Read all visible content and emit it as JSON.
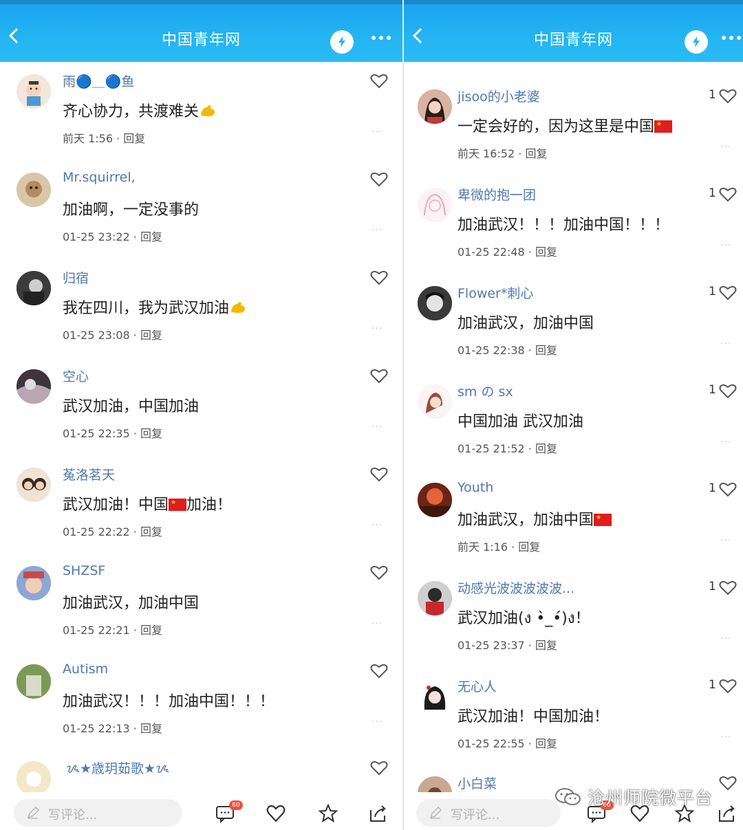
{
  "app": {
    "title": "中国青年网"
  },
  "left": {
    "comments": [
      {
        "name": "雨🔵＿🔵鱼",
        "text": "齐心协力，共渡难关",
        "emoji": "muscle",
        "time": "前天 1:56",
        "reply": "回复"
      },
      {
        "name": "Mr.squirrel,",
        "text": "加油啊，一定没事的",
        "time": "01-25 23:22",
        "reply": "回复"
      },
      {
        "name": "归宿",
        "text": "我在四川，我为武汉加油",
        "emoji": "muscle",
        "time": "01-25 23:08",
        "reply": "回复"
      },
      {
        "name": "空心",
        "text": "武汉加油，中国加油",
        "time": "01-25 22:35",
        "reply": "回复"
      },
      {
        "name": "菟洛茗天",
        "text_a": "武汉加油！中国",
        "text_b": "加油！",
        "time": "01-25 22:22",
        "reply": "回复"
      },
      {
        "name": "SHZSF",
        "text": "加油武汉，加油中国",
        "time": "01-25 22:21",
        "reply": "回复"
      },
      {
        "name": "Autism",
        "text": "加油武汉！！！加油中国！！！",
        "time": "01-25 22:13",
        "reply": "回复"
      },
      {
        "name": "ᝰ★歳玥茹歌★ᝰ"
      }
    ],
    "input_placeholder": "写评论...",
    "comment_badge": "60"
  },
  "right": {
    "comments": [
      {
        "name": "jisoo的小老婆",
        "text": "一定会好的，因为这里是中国",
        "flag": true,
        "time": "前天 16:52",
        "reply": "回复",
        "likes": "1"
      },
      {
        "name": "卑微的抱一团",
        "text": "加油武汉！！！加油中国！！！",
        "time": "01-25 22:48",
        "reply": "回复",
        "likes": "1"
      },
      {
        "name": "Flower*刺心",
        "text": "加油武汉，加油中国",
        "time": "01-25 22:38",
        "reply": "回复",
        "likes": "1"
      },
      {
        "name": "sm の sx",
        "text": "中国加油 武汉加油",
        "time": "01-25 21:52",
        "reply": "回复",
        "likes": "1"
      },
      {
        "name": "Youth",
        "text": "加油武汉，加油中国",
        "flag": true,
        "time": "前天 1:16",
        "reply": "回复",
        "likes": "1"
      },
      {
        "name": "动感光波波波波波...",
        "text": "武汉加油(ง •̀_•́)ง！",
        "time": "01-25 23:37",
        "reply": "回复",
        "likes": "1"
      },
      {
        "name": "无心人",
        "text": "武汉加油！中国加油！",
        "time": "01-25 22:55",
        "reply": "回复",
        "likes": "1"
      },
      {
        "name": "小白菜"
      }
    ],
    "input_placeholder": "写评论...",
    "comment_badge": "60"
  },
  "watermark": "沧州师院微平台",
  "icons": [
    "back-icon",
    "speed-icon",
    "more-icon",
    "heart-icon",
    "pen-icon",
    "comment-icon",
    "star-icon",
    "share-icon"
  ],
  "colors": {
    "header": "#23b4f2",
    "name": "#4f78b0",
    "text": "#222222"
  }
}
